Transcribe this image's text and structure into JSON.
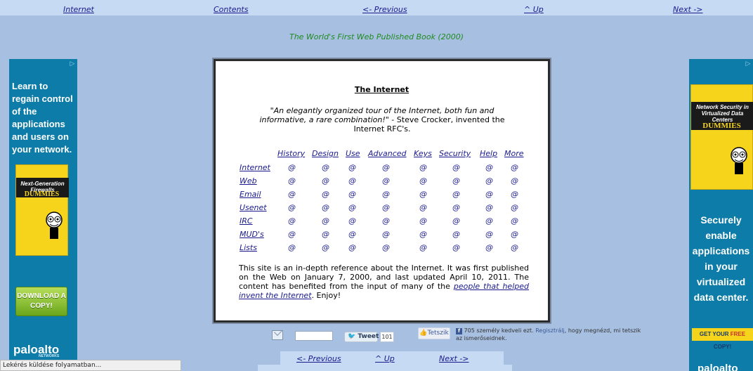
{
  "top_nav": {
    "internet": "Internet",
    "contents": "Contents",
    "previous": "<- Previous",
    "up": "^ Up",
    "next": "Next ->"
  },
  "tagline": "The World's First Web Published Book (2000)",
  "left_ad": {
    "headline": "Learn to regain control of the applications and users on your network.",
    "book_band": "Next-Generation Firewalls",
    "book_brand": "DUMMIES",
    "button": "DOWNLOAD A COPY!",
    "logo": "paloalto",
    "logo_sub": "NETWORKS"
  },
  "right_ad": {
    "book_band": "Network Security in Virtualized Data Centers",
    "book_brand": "DUMMIES",
    "headline": "Securely enable applications in your virtualized data center.",
    "button_prefix": "GET YOUR ",
    "button_free": "FREE",
    "button_suffix": " COPY!",
    "logo": "paloalto"
  },
  "content": {
    "title": "The Internet",
    "quote_italic": "\"An elegantly organized tour of the Internet, both fun and informative, a rare combination!\"",
    "quote_attr": " - Steve Crocker, invented the Internet RFC's.",
    "columns": [
      "History",
      "Design",
      "Use",
      "Advanced",
      "Keys",
      "Security",
      "Help",
      "More"
    ],
    "rows": [
      "Internet",
      "Web",
      "Email",
      "Usenet",
      "IRC",
      "MUD's",
      "Lists"
    ],
    "cell_symbol": "@",
    "desc_1": "This site is an in-depth reference about the Internet. It was first published on the Web on January 7, 2000, and last updated April 10, 2011. The content has benefited from the input of many of the ",
    "desc_link": "people that helped invent the Internet",
    "desc_2": ". Enjoy!"
  },
  "social": {
    "tweet_label": "Tweet",
    "tweet_count": "101",
    "like_label": "Tetszik",
    "fb_prefix": "705 személy kedveli ezt.",
    "fb_link": "Regisztrálj",
    "fb_suffix": ", hogy megnézd, mi tetszik az ismerőseidnek."
  },
  "bottom_nav": {
    "previous": "<- Previous",
    "up": "^ Up",
    "next": "Next ->"
  },
  "status_bar": "Lekérés küldése folyamatban..."
}
